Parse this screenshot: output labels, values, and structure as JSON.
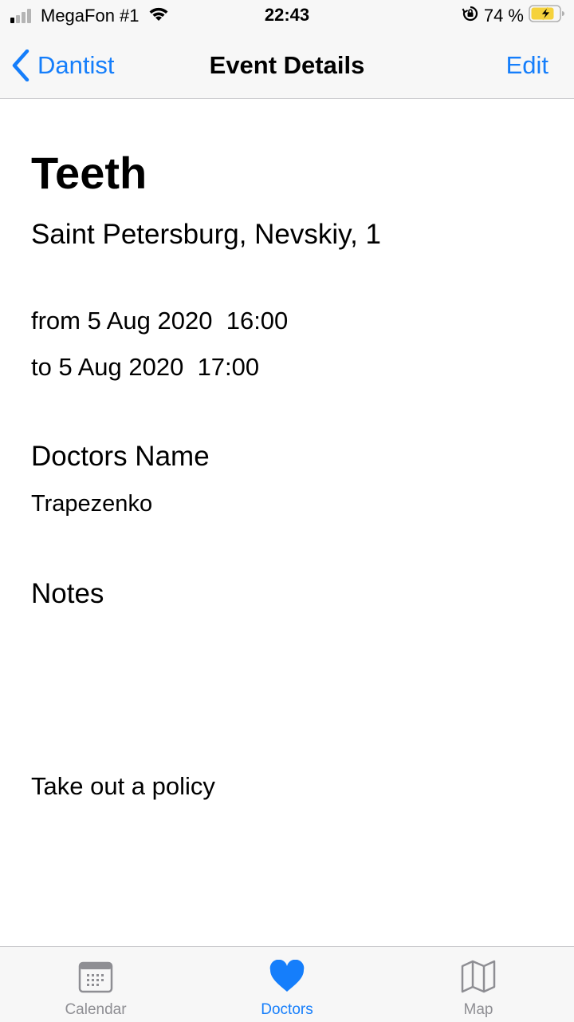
{
  "status_bar": {
    "carrier": "MegaFon #1",
    "time": "22:43",
    "battery_percent": "74 %",
    "signal_bars_active": 1,
    "signal_bars_total": 4,
    "icons": [
      "signal-icon",
      "wifi-icon",
      "orientation-lock-icon",
      "battery-charging-icon"
    ]
  },
  "nav": {
    "back_label": "Dantist",
    "title": "Event Details",
    "edit_label": "Edit"
  },
  "event": {
    "title": "Teeth",
    "location": "Saint Petersburg, Nevskiy, 1",
    "from": "from 5 Aug 2020  16:00",
    "to": "to 5 Aug 2020  17:00"
  },
  "doctor": {
    "heading": "Doctors Name",
    "name": "Trapezenko"
  },
  "notes": {
    "heading": "Notes",
    "text": "Take out a policy"
  },
  "tabs": [
    {
      "label": "Calendar",
      "icon": "calendar-icon",
      "active": false
    },
    {
      "label": "Doctors",
      "icon": "heart-icon",
      "active": true
    },
    {
      "label": "Map",
      "icon": "map-icon",
      "active": false
    }
  ],
  "colors": {
    "accent": "#157efb",
    "inactive_tab": "#8e8e93",
    "bar_background": "#f7f7f7",
    "battery_fill": "#f5d23c"
  }
}
